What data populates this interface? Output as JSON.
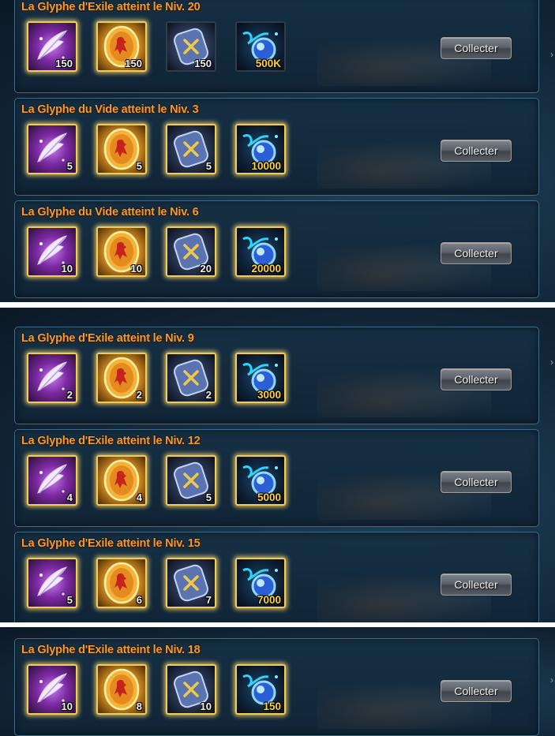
{
  "button_label": "Collecter",
  "icons": {
    "feather": "purple-feather-icon",
    "medal": "golden-emblem-icon",
    "rune": "blue-rune-icon",
    "orb": "blue-energy-orb-icon"
  },
  "colors": {
    "title": "#f29a2e",
    "orb_count": "#ffd23a",
    "gold_frame": "#f3cc55"
  },
  "screenshots": [
    {
      "rows": [
        {
          "title": "La Glyphe d'Exile atteint le Niv. 20",
          "counts": [
            "150",
            "150",
            "150",
            "500K"
          ],
          "gold": [
            true,
            true,
            false,
            false
          ]
        },
        {
          "title": "La Glyphe du Vide atteint le Niv. 3",
          "counts": [
            "5",
            "5",
            "5",
            "10000"
          ],
          "gold": [
            true,
            true,
            true,
            true
          ]
        },
        {
          "title": "La Glyphe du Vide atteint le Niv. 6",
          "counts": [
            "10",
            "10",
            "20",
            "20000"
          ],
          "gold": [
            true,
            true,
            true,
            true
          ]
        }
      ]
    },
    {
      "rows": [
        {
          "title": "La Glyphe d'Exile atteint le Niv. 9",
          "counts": [
            "2",
            "2",
            "2",
            "3000"
          ],
          "gold": [
            true,
            true,
            true,
            true
          ]
        },
        {
          "title": "La Glyphe d'Exile atteint le Niv. 12",
          "counts": [
            "4",
            "4",
            "5",
            "5000"
          ],
          "gold": [
            true,
            true,
            true,
            true
          ]
        },
        {
          "title": "La Glyphe d'Exile atteint le Niv. 15",
          "counts": [
            "5",
            "6",
            "7",
            "7000"
          ],
          "gold": [
            true,
            true,
            true,
            true
          ]
        }
      ]
    },
    {
      "rows": [
        {
          "title": "La Glyphe d'Exile atteint le Niv. 18",
          "counts": [
            "10",
            "8",
            "10",
            "150"
          ],
          "gold": [
            true,
            true,
            true,
            true
          ]
        }
      ]
    }
  ]
}
